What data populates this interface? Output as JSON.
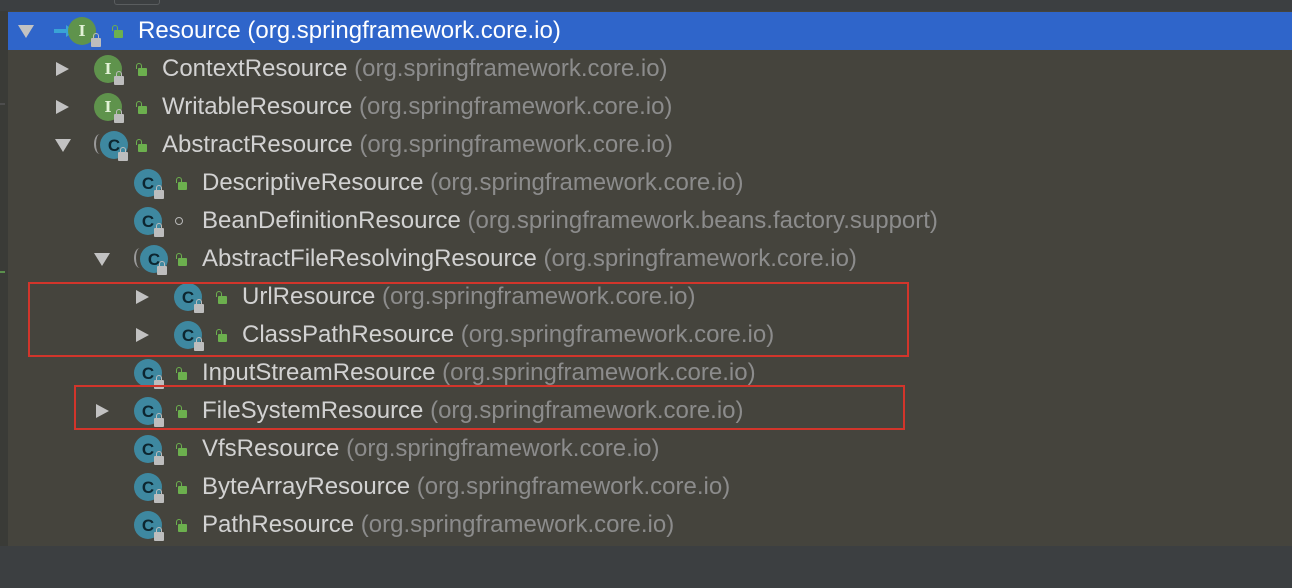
{
  "tree": {
    "rows": [
      {
        "name": "Resource",
        "pkg": "(org.springframework.core.io)"
      },
      {
        "name": "ContextResource",
        "pkg": "(org.springframework.core.io)"
      },
      {
        "name": "WritableResource",
        "pkg": "(org.springframework.core.io)"
      },
      {
        "name": "AbstractResource",
        "pkg": "(org.springframework.core.io)"
      },
      {
        "name": "DescriptiveResource",
        "pkg": "(org.springframework.core.io)"
      },
      {
        "name": "BeanDefinitionResource",
        "pkg": "(org.springframework.beans.factory.support)"
      },
      {
        "name": "AbstractFileResolvingResource",
        "pkg": "(org.springframework.core.io)"
      },
      {
        "name": "UrlResource",
        "pkg": "(org.springframework.core.io)"
      },
      {
        "name": "ClassPathResource",
        "pkg": "(org.springframework.core.io)"
      },
      {
        "name": "InputStreamResource",
        "pkg": "(org.springframework.core.io)"
      },
      {
        "name": "FileSystemResource",
        "pkg": "(org.springframework.core.io)"
      },
      {
        "name": "VfsResource",
        "pkg": "(org.springframework.core.io)"
      },
      {
        "name": "ByteArrayResource",
        "pkg": "(org.springframework.core.io)"
      },
      {
        "name": "PathResource",
        "pkg": "(org.springframework.core.io)"
      }
    ]
  },
  "badges": {
    "interface_letter": "I",
    "class_letter": "C"
  },
  "colors": {
    "selection": "#2f65ca",
    "panel_bg": "#45443d",
    "highlight_box": "#d2352b",
    "interface_badge": "#5f934c",
    "class_badge": "#3e88a0"
  },
  "icons": [
    "implementation-arrow-icon",
    "interface-icon",
    "class-icon",
    "abstract-class-icon",
    "lock-icon",
    "public-visibility-icon",
    "package-visibility-icon",
    "expand-arrow-icon",
    "collapse-arrow-icon"
  ]
}
